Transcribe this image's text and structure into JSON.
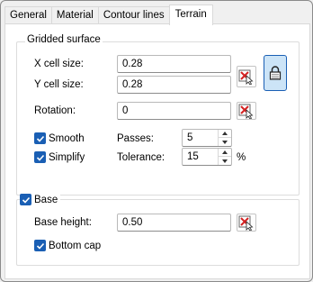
{
  "tabs": [
    {
      "label": "General"
    },
    {
      "label": "Material"
    },
    {
      "label": "Contour lines"
    },
    {
      "label": "Terrain"
    }
  ],
  "active_tab": "Terrain",
  "gridded_surface": {
    "title": "Gridded surface",
    "x_cell_size": {
      "label": "X cell size:",
      "value": "0.28"
    },
    "y_cell_size": {
      "label": "Y cell size:",
      "value": "0.28"
    },
    "rotation": {
      "label": "Rotation:",
      "value": "0"
    },
    "smooth": {
      "label": "Smooth",
      "checked": true
    },
    "simplify": {
      "label": "Simplify",
      "checked": true
    },
    "passes": {
      "label": "Passes:",
      "value": "5"
    },
    "tolerance": {
      "label": "Tolerance:",
      "value": "15",
      "unit": "%"
    }
  },
  "base": {
    "label": "Base",
    "checked": true,
    "base_height": {
      "label": "Base height:",
      "value": "0.50"
    },
    "bottom_cap": {
      "label": "Bottom cap",
      "checked": true
    }
  },
  "colors": {
    "accent": "#1a5fb4",
    "lock_button_bg": "#cce4f7",
    "pick_icon_red": "#d42020"
  },
  "icons": {
    "pick_button": "pick-from-model-icon",
    "lock": "lock-icon",
    "check": "check-icon"
  }
}
